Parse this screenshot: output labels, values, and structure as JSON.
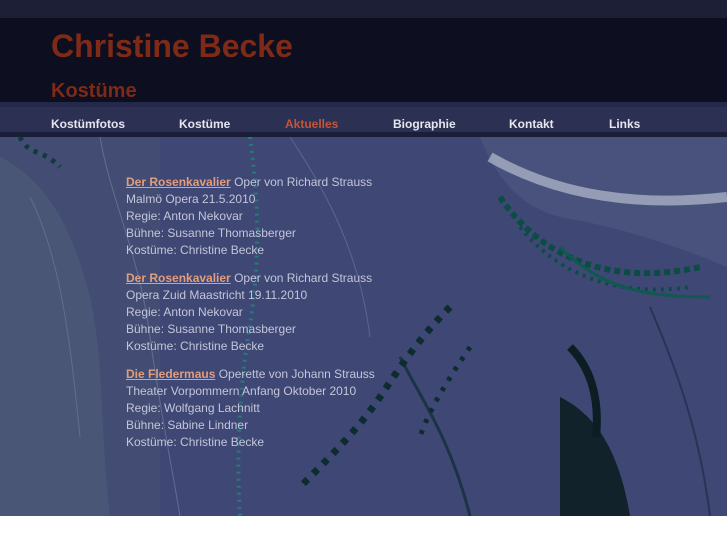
{
  "header": {
    "title": "Christine Becke",
    "subtitle": "Kostüme"
  },
  "nav": {
    "items": [
      {
        "label": "Kostümfotos",
        "active": false
      },
      {
        "label": "Kostüme",
        "active": false
      },
      {
        "label": "Aktuelles",
        "active": true
      },
      {
        "label": "Biographie",
        "active": false
      },
      {
        "label": "Kontakt",
        "active": false
      },
      {
        "label": "Links",
        "active": false
      }
    ]
  },
  "entries": [
    {
      "title_link": "Der Rosenkavalier",
      "title_rest": " Oper von Richard Strauss",
      "venue": "Malmö Opera 21.5.2010",
      "regie": "Regie: Anton Nekovar",
      "buehne": "Bühne: Susanne Thomasberger",
      "kostueme": "Kostüme: Christine Becke"
    },
    {
      "title_link": "Der Rosenkavalier",
      "title_rest": " Oper von Richard Strauss",
      "venue": "Opera Zuid Maastricht 19.11.2010",
      "regie": "Regie: Anton Nekovar",
      "buehne": "Bühne: Susanne Thomasberger",
      "kostueme": "Kostüme: Christine Becke"
    },
    {
      "title_link": "Die Fledermaus",
      "title_rest": " Operette von Johann Strauss",
      "venue": "Theater Vorpommern Anfang Oktober 2010",
      "regie": "Regie: Wolfgang Lachnitt",
      "buehne": "Bühne: Sabine Lindner",
      "kostueme": "Kostüme: Christine Becke"
    }
  ],
  "colors": {
    "title": "#7f2a16",
    "active_nav": "#c2553a",
    "link": "#e19e7e",
    "content_bg": "#3f4775"
  }
}
